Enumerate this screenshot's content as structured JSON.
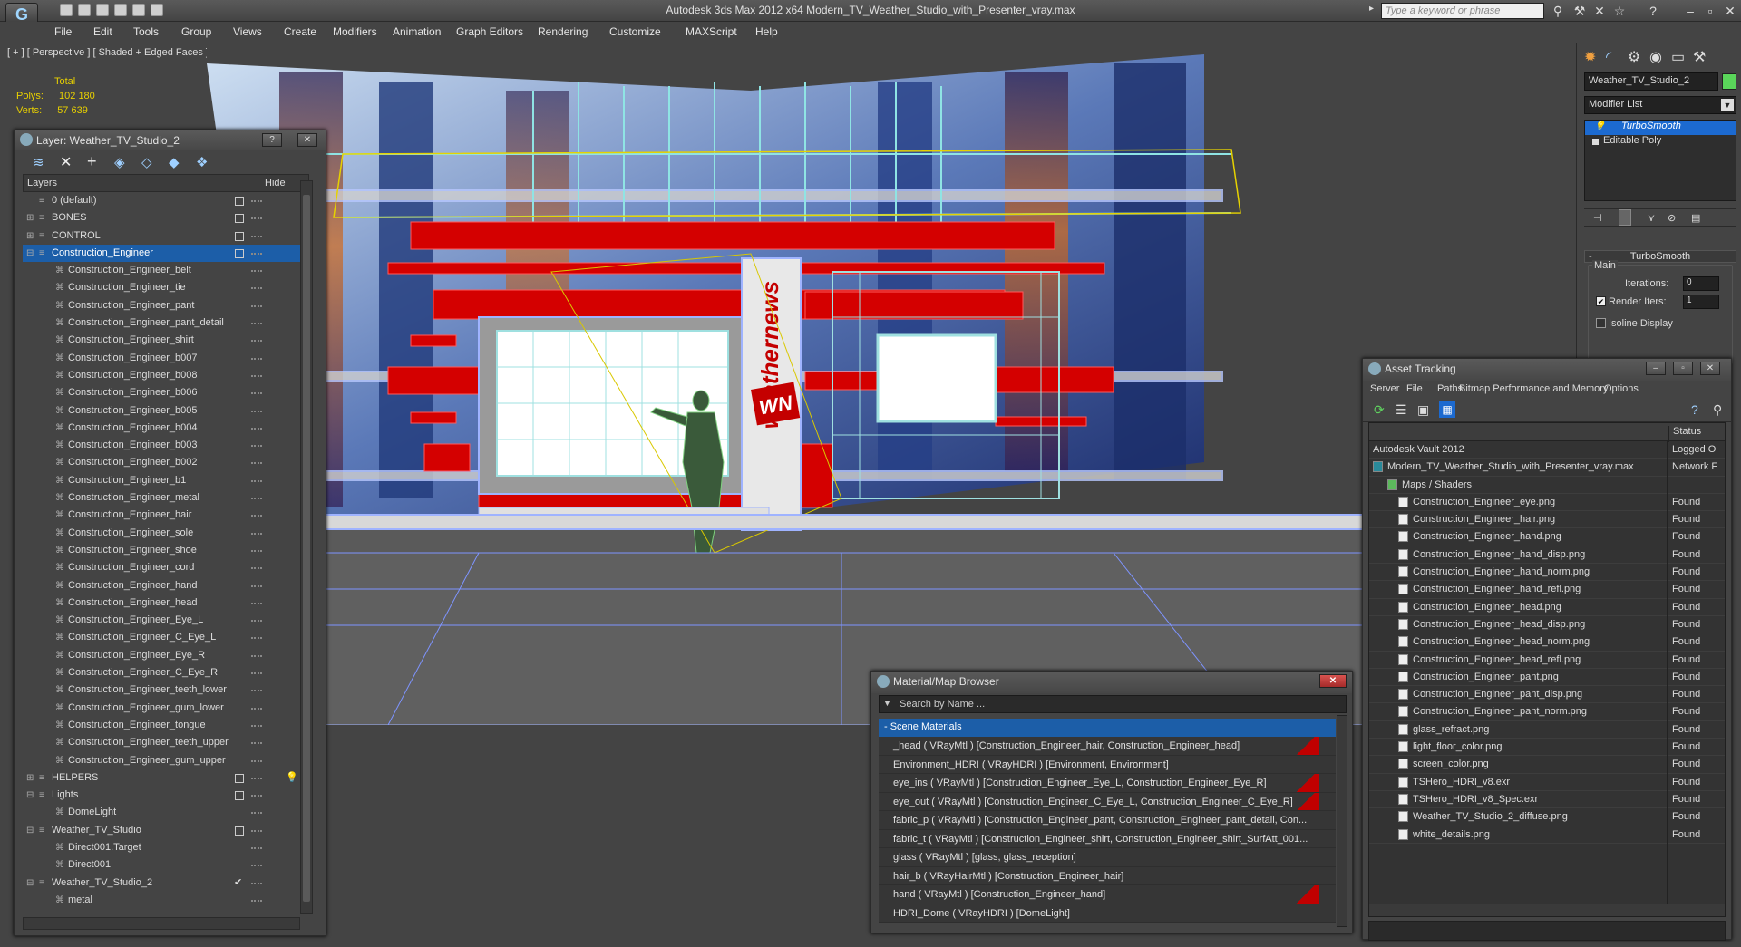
{
  "app": {
    "title": "Autodesk 3ds Max  2012 x64      Modern_TV_Weather_Studio_with_Presenter_vray.max",
    "logo_text": "G",
    "search_placeholder": "Type a keyword or phrase"
  },
  "menu": [
    "File",
    "Edit",
    "Tools",
    "Group",
    "Views",
    "Create",
    "Modifiers",
    "Animation",
    "Graph Editors",
    "Rendering",
    "Customize",
    "MAXScript",
    "Help"
  ],
  "viewport": {
    "label": "[ + ] [ Perspective ] [ Shaded + Edged Faces ]",
    "stats": {
      "total_label": "Total",
      "polys_label": "Polys:",
      "polys": "102 180",
      "verts_label": "Verts:",
      "verts": "57 639"
    },
    "logo_text": "weathernews",
    "logo_badge": "WN"
  },
  "layer_panel": {
    "title": "Layer: Weather_TV_Studio_2",
    "help": "?",
    "close": "✕",
    "col_layers": "Layers",
    "col_hide": "Hide",
    "rows": [
      {
        "name": "0 (default)",
        "level": 0,
        "hide": "box"
      },
      {
        "name": "BONES",
        "level": 0,
        "hide": "box",
        "plus": "⊞"
      },
      {
        "name": "CONTROL",
        "level": 0,
        "hide": "box",
        "plus": "⊞"
      },
      {
        "name": "Construction_Engineer",
        "level": 0,
        "hide": "box",
        "plus": "⊟",
        "selected": true
      },
      {
        "name": "Construction_Engineer_belt",
        "level": 1
      },
      {
        "name": "Construction_Engineer_tie",
        "level": 1
      },
      {
        "name": "Construction_Engineer_pant",
        "level": 1
      },
      {
        "name": "Construction_Engineer_pant_detail",
        "level": 1
      },
      {
        "name": "Construction_Engineer_shirt",
        "level": 1
      },
      {
        "name": "Construction_Engineer_b007",
        "level": 1
      },
      {
        "name": "Construction_Engineer_b008",
        "level": 1
      },
      {
        "name": "Construction_Engineer_b006",
        "level": 1
      },
      {
        "name": "Construction_Engineer_b005",
        "level": 1
      },
      {
        "name": "Construction_Engineer_b004",
        "level": 1
      },
      {
        "name": "Construction_Engineer_b003",
        "level": 1
      },
      {
        "name": "Construction_Engineer_b002",
        "level": 1
      },
      {
        "name": "Construction_Engineer_b1",
        "level": 1
      },
      {
        "name": "Construction_Engineer_metal",
        "level": 1
      },
      {
        "name": "Construction_Engineer_hair",
        "level": 1
      },
      {
        "name": "Construction_Engineer_sole",
        "level": 1
      },
      {
        "name": "Construction_Engineer_shoe",
        "level": 1
      },
      {
        "name": "Construction_Engineer_cord",
        "level": 1
      },
      {
        "name": "Construction_Engineer_hand",
        "level": 1
      },
      {
        "name": "Construction_Engineer_head",
        "level": 1
      },
      {
        "name": "Construction_Engineer_Eye_L",
        "level": 1
      },
      {
        "name": "Construction_Engineer_C_Eye_L",
        "level": 1
      },
      {
        "name": "Construction_Engineer_Eye_R",
        "level": 1
      },
      {
        "name": "Construction_Engineer_C_Eye_R",
        "level": 1
      },
      {
        "name": "Construction_Engineer_teeth_lower",
        "level": 1
      },
      {
        "name": "Construction_Engineer_gum_lower",
        "level": 1
      },
      {
        "name": "Construction_Engineer_tongue",
        "level": 1
      },
      {
        "name": "Construction_Engineer_teeth_upper",
        "level": 1
      },
      {
        "name": "Construction_Engineer_gum_upper",
        "level": 1
      },
      {
        "name": "HELPERS",
        "level": 0,
        "hide": "box",
        "plus": "⊞",
        "bulb": true
      },
      {
        "name": "Lights",
        "level": 0,
        "hide": "box",
        "plus": "⊟"
      },
      {
        "name": "DomeLight",
        "level": 1
      },
      {
        "name": "Weather_TV_Studio",
        "level": 0,
        "hide": "box",
        "plus": "⊟"
      },
      {
        "name": "Direct001.Target",
        "level": 1
      },
      {
        "name": "Direct001",
        "level": 1
      },
      {
        "name": "Weather_TV_Studio_2",
        "level": 0,
        "hide": "check",
        "plus": "⊟"
      },
      {
        "name": "metal",
        "level": 1
      }
    ]
  },
  "command_panel": {
    "object_name": "Weather_TV_Studio_2",
    "object_color": "#5ad65a",
    "modifier_list": "Modifier List",
    "stack": [
      {
        "name": "TurboSmooth",
        "selected": true
      },
      {
        "name": "Editable Poly"
      }
    ],
    "rollout_title": "TurboSmooth",
    "group_main": "Main",
    "iterations_label": "Iterations:",
    "iterations": "0",
    "render_iters_label": "Render Iters:",
    "render_iters": "1",
    "isoline_label": "Isoline Display"
  },
  "asset_tracking": {
    "title": "Asset Tracking",
    "menu": [
      "Server",
      "File",
      "Paths",
      "Bitmap Performance and Memory",
      "Options"
    ],
    "col_status": "Status",
    "rows": [
      {
        "name": "Autodesk Vault 2012",
        "status": "Logged O",
        "level": 0,
        "icon": "none"
      },
      {
        "name": "Modern_TV_Weather_Studio_with_Presenter_vray.max",
        "status": "Network F",
        "level": 0,
        "icon": "max"
      },
      {
        "name": "Maps / Shaders",
        "status": "",
        "level": 1,
        "icon": "folder"
      },
      {
        "name": "Construction_Engineer_eye.png",
        "status": "Found",
        "level": 2,
        "icon": "file"
      },
      {
        "name": "Construction_Engineer_hair.png",
        "status": "Found",
        "level": 2,
        "icon": "file"
      },
      {
        "name": "Construction_Engineer_hand.png",
        "status": "Found",
        "level": 2,
        "icon": "file"
      },
      {
        "name": "Construction_Engineer_hand_disp.png",
        "status": "Found",
        "level": 2,
        "icon": "file"
      },
      {
        "name": "Construction_Engineer_hand_norm.png",
        "status": "Found",
        "level": 2,
        "icon": "file"
      },
      {
        "name": "Construction_Engineer_hand_refl.png",
        "status": "Found",
        "level": 2,
        "icon": "file"
      },
      {
        "name": "Construction_Engineer_head.png",
        "status": "Found",
        "level": 2,
        "icon": "file"
      },
      {
        "name": "Construction_Engineer_head_disp.png",
        "status": "Found",
        "level": 2,
        "icon": "file"
      },
      {
        "name": "Construction_Engineer_head_norm.png",
        "status": "Found",
        "level": 2,
        "icon": "file"
      },
      {
        "name": "Construction_Engineer_head_refl.png",
        "status": "Found",
        "level": 2,
        "icon": "file"
      },
      {
        "name": "Construction_Engineer_pant.png",
        "status": "Found",
        "level": 2,
        "icon": "file"
      },
      {
        "name": "Construction_Engineer_pant_disp.png",
        "status": "Found",
        "level": 2,
        "icon": "file"
      },
      {
        "name": "Construction_Engineer_pant_norm.png",
        "status": "Found",
        "level": 2,
        "icon": "file"
      },
      {
        "name": "glass_refract.png",
        "status": "Found",
        "level": 2,
        "icon": "file"
      },
      {
        "name": "light_floor_color.png",
        "status": "Found",
        "level": 2,
        "icon": "file"
      },
      {
        "name": "screen_color.png",
        "status": "Found",
        "level": 2,
        "icon": "file"
      },
      {
        "name": "TSHero_HDRI_v8.exr",
        "status": "Found",
        "level": 2,
        "icon": "file"
      },
      {
        "name": "TSHero_HDRI_v8_Spec.exr",
        "status": "Found",
        "level": 2,
        "icon": "file"
      },
      {
        "name": "Weather_TV_Studio_2_diffuse.png",
        "status": "Found",
        "level": 2,
        "icon": "file"
      },
      {
        "name": "white_details.png",
        "status": "Found",
        "level": 2,
        "icon": "file"
      }
    ]
  },
  "material_browser": {
    "title": "Material/Map Browser",
    "search_placeholder": "Search by Name ...",
    "group": "- Scene Materials",
    "rows": [
      {
        "text": "_head  ( VRayMtl ) [Construction_Engineer_hair, Construction_Engineer_head]",
        "red": true
      },
      {
        "text": "Environment_HDRI  ( VRayHDRI ) [Environment, Environment]",
        "red": false
      },
      {
        "text": "eye_ins  ( VRayMtl ) [Construction_Engineer_Eye_L, Construction_Engineer_Eye_R]",
        "red": true
      },
      {
        "text": "eye_out  ( VRayMtl ) [Construction_Engineer_C_Eye_L, Construction_Engineer_C_Eye_R]",
        "red": true
      },
      {
        "text": "fabric_p  ( VRayMtl ) [Construction_Engineer_pant, Construction_Engineer_pant_detail, Con...",
        "red": false
      },
      {
        "text": "fabric_t  ( VRayMtl ) [Construction_Engineer_shirt, Construction_Engineer_shirt_SurfAtt_001...",
        "red": false
      },
      {
        "text": "glass  ( VRayMtl ) [glass, glass_reception]",
        "red": false
      },
      {
        "text": "hair_b  ( VRayHairMtl ) [Construction_Engineer_hair]",
        "red": false
      },
      {
        "text": "hand  ( VRayMtl ) [Construction_Engineer_hand]",
        "red": true
      },
      {
        "text": "HDRI_Dome  ( VRayHDRI ) [DomeLight]",
        "red": false
      }
    ]
  }
}
